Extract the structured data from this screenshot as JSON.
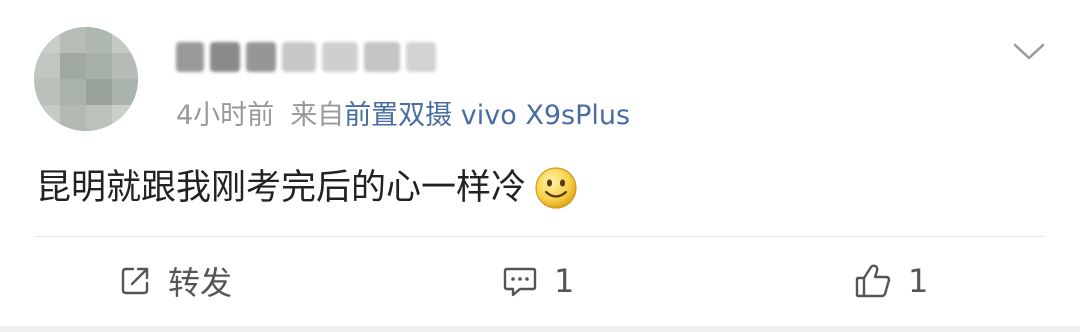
{
  "post": {
    "time": "4小时前",
    "source_prefix": "来自",
    "device": "前置双摄 vivo X9sPlus",
    "text": "昆明就跟我刚考完后的心一样冷"
  },
  "actions": {
    "forward_label": "转发",
    "comment_count": "1",
    "like_count": "1"
  },
  "icons": {
    "avatar": "pixelated-avatar",
    "username": "pixelated-username",
    "menu": "chevron-down-icon",
    "emoji": "smiley-emoji",
    "forward": "share-icon",
    "comment": "comment-icon",
    "like": "thumbs-up-icon"
  },
  "colors": {
    "link": "#4a6d9f",
    "meta_text": "#999999",
    "body_text": "#222222",
    "divider": "#e6e6e6"
  }
}
